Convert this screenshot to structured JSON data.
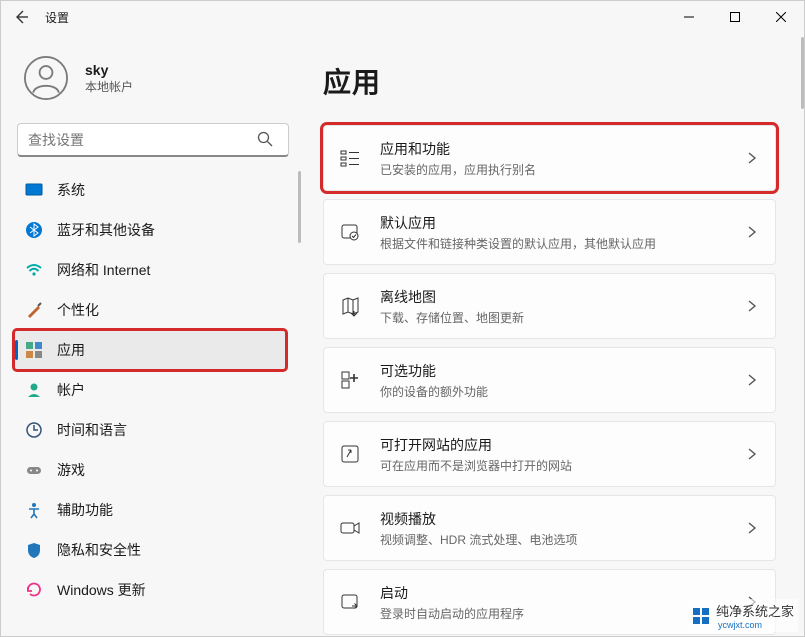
{
  "window": {
    "title": "设置"
  },
  "user": {
    "name": "sky",
    "account_type": "本地帐户"
  },
  "search": {
    "placeholder": "查找设置"
  },
  "nav": {
    "items": [
      {
        "label": "系统"
      },
      {
        "label": "蓝牙和其他设备"
      },
      {
        "label": "网络和 Internet"
      },
      {
        "label": "个性化"
      },
      {
        "label": "应用"
      },
      {
        "label": "帐户"
      },
      {
        "label": "时间和语言"
      },
      {
        "label": "游戏"
      },
      {
        "label": "辅助功能"
      },
      {
        "label": "隐私和安全性"
      },
      {
        "label": "Windows 更新"
      }
    ],
    "active_index": 4
  },
  "page": {
    "title": "应用"
  },
  "cards": [
    {
      "title": "应用和功能",
      "sub": "已安装的应用，应用执行别名"
    },
    {
      "title": "默认应用",
      "sub": "根据文件和链接种类设置的默认应用，其他默认应用"
    },
    {
      "title": "离线地图",
      "sub": "下载、存储位置、地图更新"
    },
    {
      "title": "可选功能",
      "sub": "你的设备的额外功能"
    },
    {
      "title": "可打开网站的应用",
      "sub": "可在应用而不是浏览器中打开的网站"
    },
    {
      "title": "视频播放",
      "sub": "视频调整、HDR 流式处理、电池选项"
    },
    {
      "title": "启动",
      "sub": "登录时自动启动的应用程序"
    }
  ],
  "watermark": {
    "text": "纯净系统之家",
    "url": "ycwjxt.com"
  }
}
